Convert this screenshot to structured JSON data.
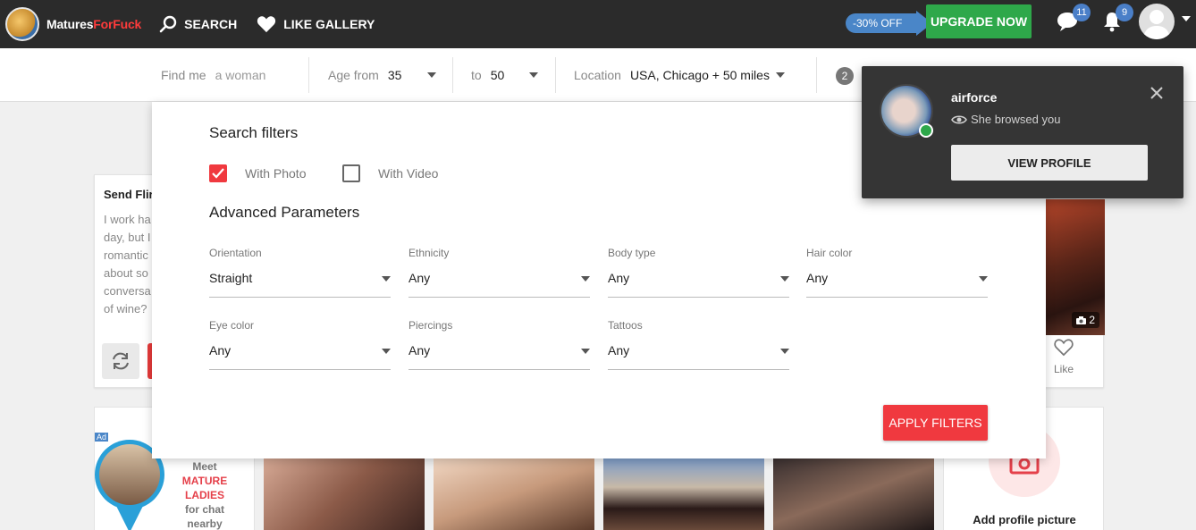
{
  "brand": {
    "name_part1": "Matures",
    "name_part2": "ForFuck"
  },
  "nav": {
    "search_label": "SEARCH",
    "gallery_label": "LIKE GALLERY"
  },
  "promo": {
    "discount": "-30% OFF",
    "upgrade_label": "UPGRADE NOW"
  },
  "counts": {
    "messages": "11",
    "notifications": "9"
  },
  "search": {
    "find_label": "Find me",
    "find_value": "a woman",
    "age_from_label": "Age from",
    "age_from_value": "35",
    "age_to_label": "to",
    "age_to_value": "50",
    "location_label": "Location",
    "location_value": "USA, Chicago + 50 miles",
    "filter_count": "2"
  },
  "filters": {
    "title": "Search filters",
    "with_photo": "With Photo",
    "with_video": "With Video",
    "with_photo_checked": true,
    "with_video_checked": false,
    "advanced_title": "Advanced Parameters",
    "fields": [
      {
        "label": "Orientation",
        "value": "Straight"
      },
      {
        "label": "Ethnicity",
        "value": "Any"
      },
      {
        "label": "Body type",
        "value": "Any"
      },
      {
        "label": "Hair color",
        "value": "Any"
      },
      {
        "label": "Eye color",
        "value": "Any"
      },
      {
        "label": "Piercings",
        "value": "Any"
      },
      {
        "label": "Tattoos",
        "value": "Any"
      }
    ],
    "apply_label": "APPLY FILTERS"
  },
  "flirt_card": {
    "title": "Send Flir",
    "lines": [
      "I work ha",
      "day, but I",
      "romantic",
      "about so",
      "conversa",
      "of wine?"
    ]
  },
  "profile_card": {
    "photo_count": "2",
    "like_label": "Like"
  },
  "ad": {
    "tag": "Ad",
    "line1": "Meet",
    "line2": "MATURE LADIES",
    "line3": "for chat",
    "line4": "nearby"
  },
  "add_picture": {
    "label": "Add profile picture"
  },
  "notification": {
    "username": "airforce",
    "message": "She browsed you",
    "button_label": "VIEW PROFILE"
  },
  "colors": {
    "accent_red": "#f0393f",
    "upgrade_green": "#2ea84a",
    "promo_blue": "#4a86c8",
    "topbar": "#2b2b2b"
  }
}
